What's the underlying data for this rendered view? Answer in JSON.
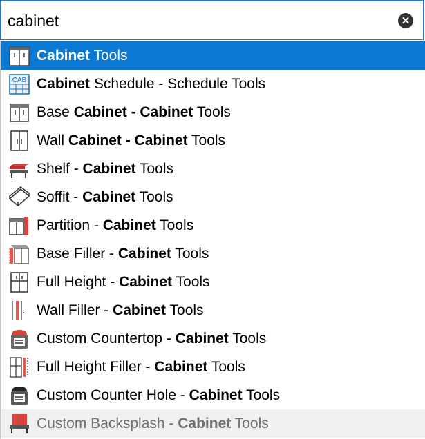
{
  "search": {
    "value": "cabinet"
  },
  "results": [
    {
      "pre": "",
      "bold": "Cabinet",
      "post": " Tools",
      "bold2": "",
      "post2": "",
      "icon": "cabinet-tools-icon"
    },
    {
      "pre": "",
      "bold": "Cabinet",
      "post": " Schedule - Schedule Tools",
      "bold2": "",
      "post2": "",
      "icon": "cabinet-schedule-icon"
    },
    {
      "pre": "Base ",
      "bold": "Cabinet - Cabinet",
      "post": " Tools",
      "bold2": "",
      "post2": "",
      "icon": "base-cabinet-icon"
    },
    {
      "pre": "Wall ",
      "bold": "Cabinet - Cabinet",
      "post": " Tools",
      "bold2": "",
      "post2": "",
      "icon": "wall-cabinet-icon"
    },
    {
      "pre": "Shelf - ",
      "bold": "Cabinet",
      "post": " Tools",
      "bold2": "",
      "post2": "",
      "icon": "shelf-icon"
    },
    {
      "pre": "Soffit - ",
      "bold": "Cabinet",
      "post": " Tools",
      "bold2": "",
      "post2": "",
      "icon": "soffit-icon"
    },
    {
      "pre": "Partition - ",
      "bold": "Cabinet",
      "post": " Tools",
      "bold2": "",
      "post2": "",
      "icon": "partition-icon"
    },
    {
      "pre": "Base Filler - ",
      "bold": "Cabinet",
      "post": " Tools",
      "bold2": "",
      "post2": "",
      "icon": "base-filler-icon"
    },
    {
      "pre": "Full Height - ",
      "bold": "Cabinet",
      "post": " Tools",
      "bold2": "",
      "post2": "",
      "icon": "full-height-icon"
    },
    {
      "pre": "Wall Filler - ",
      "bold": "Cabinet",
      "post": " Tools",
      "bold2": "",
      "post2": "",
      "icon": "wall-filler-icon"
    },
    {
      "pre": "Custom Countertop - ",
      "bold": "Cabinet",
      "post": " Tools",
      "bold2": "",
      "post2": "",
      "icon": "custom-countertop-icon"
    },
    {
      "pre": "Full Height Filler - ",
      "bold": "Cabinet",
      "post": " Tools",
      "bold2": "",
      "post2": "",
      "icon": "full-height-filler-icon"
    },
    {
      "pre": "Custom Counter Hole - ",
      "bold": "Cabinet",
      "post": " Tools",
      "bold2": "",
      "post2": "",
      "icon": "custom-counter-hole-icon"
    },
    {
      "pre": "Custom Backsplash - ",
      "bold": "Cabinet",
      "post": " Tools",
      "bold2": "",
      "post2": "",
      "icon": "custom-backsplash-icon"
    }
  ],
  "colors": {
    "selected_bg": "#0b78d4",
    "border": "#1f7ad1",
    "dim_bg": "#f0f0f0"
  }
}
